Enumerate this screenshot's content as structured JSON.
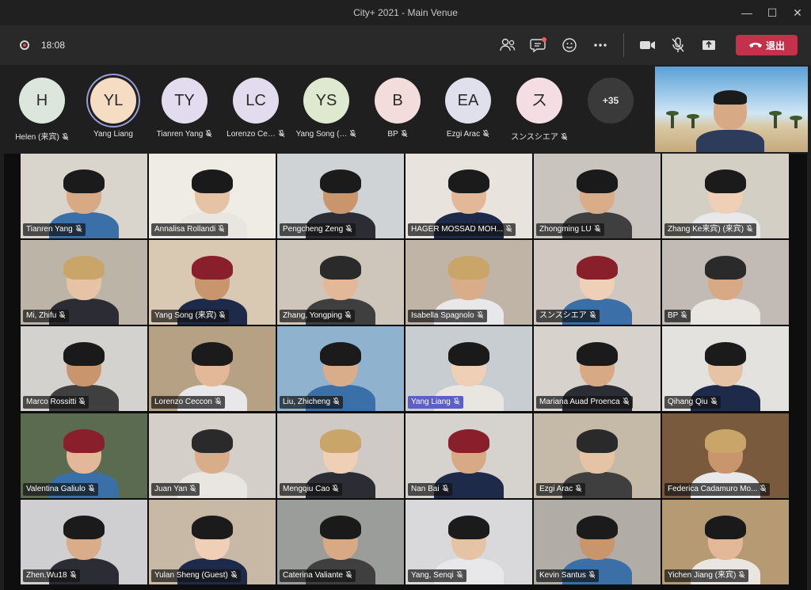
{
  "window": {
    "title": "City+ 2021 - Main Venue"
  },
  "toolbar": {
    "timer": "18:08",
    "leave_label": "退出"
  },
  "icons": {
    "record": "record-indicator-icon",
    "participants": "people-icon",
    "chat": "chat-icon",
    "reactions": "raise-hand-icon",
    "more": "more-actions-icon",
    "camera": "camera-icon",
    "mic": "mic-off-icon",
    "share": "share-tray-icon",
    "leave": "phone-hangup-icon"
  },
  "strip": {
    "participants": [
      {
        "initials": "H",
        "name": "Helen (来宾)",
        "color": "#dde6dc"
      },
      {
        "initials": "YL",
        "name": "Yang Liang",
        "color": "#f5ddc3"
      },
      {
        "initials": "TY",
        "name": "Tianren Yang",
        "color": "#e3dcef"
      },
      {
        "initials": "LC",
        "name": "Lorenzo Ce…",
        "color": "#e3dcef"
      },
      {
        "initials": "YS",
        "name": "Yang Song (…",
        "color": "#dfe9cf"
      },
      {
        "initials": "B",
        "name": "BP",
        "color": "#f3dcdc"
      },
      {
        "initials": "EA",
        "name": "Ezgi Arac",
        "color": "#dfe0ec"
      },
      {
        "initials": "ス",
        "name": "スンスシエア",
        "color": "#f5dde4"
      }
    ],
    "more_count": "+35"
  },
  "grid": {
    "rows": [
      [
        {
          "name": "Tianren Yang"
        },
        {
          "name": "Annalisa Rollandi"
        },
        {
          "name": "Pengcheng Zeng"
        },
        {
          "name": "HAGER MOSSAD MOH..."
        },
        {
          "name": "Zhongming LU"
        },
        {
          "name": "Zhang Ke来宾) (来宾)"
        }
      ],
      [
        {
          "name": "Mi, Zhifu"
        },
        {
          "name": "Yang Song (来宾)"
        },
        {
          "name": "Zhang, Yongping"
        },
        {
          "name": "Isabella Spagnolo"
        },
        {
          "name": "スンスシエア"
        },
        {
          "name": "BP"
        }
      ],
      [
        {
          "name": "Marco Rossitti"
        },
        {
          "name": "Lorenzo Ceccon"
        },
        {
          "name": "Liu, Zhicheng"
        },
        {
          "name": "Yang Liang",
          "highlight": true
        },
        {
          "name": "Mariana Auad Proenca"
        },
        {
          "name": "Qihang Qiu"
        }
      ],
      [
        {
          "name": "Valentina Galiulo"
        },
        {
          "name": "Juan Yan"
        },
        {
          "name": "Mengqiu Cao"
        },
        {
          "name": "Nan Bai"
        },
        {
          "name": "Ezgi Arac"
        },
        {
          "name": "Federica Cadamuro Mo..."
        }
      ],
      [
        {
          "name": "Zhen.Wu18"
        },
        {
          "name": "Yulan Sheng (Guest)"
        },
        {
          "name": "Caterina Valiante"
        },
        {
          "name": "Yang, Senqi"
        },
        {
          "name": "Kevin Santus"
        },
        {
          "name": "Yichen Jiang (来宾)"
        }
      ]
    ]
  }
}
